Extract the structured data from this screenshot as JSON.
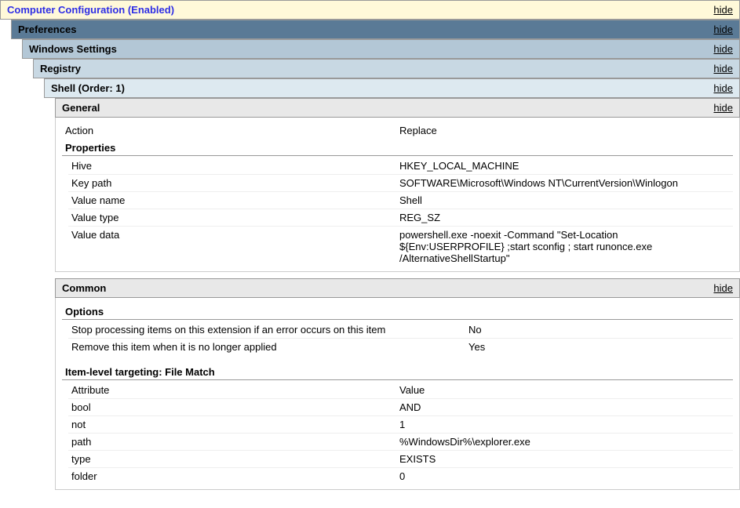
{
  "hide_label": "hide",
  "sections": {
    "computer_config": "Computer Configuration (Enabled)",
    "preferences": "Preferences",
    "windows_settings": "Windows Settings",
    "registry": "Registry",
    "shell": "Shell (Order: 1)",
    "general": "General",
    "common": "Common"
  },
  "general": {
    "action_label": "Action",
    "action_value": "Replace",
    "properties_header": "Properties",
    "rows": [
      {
        "label": "Hive",
        "value": "HKEY_LOCAL_MACHINE"
      },
      {
        "label": "Key path",
        "value": "SOFTWARE\\Microsoft\\Windows NT\\CurrentVersion\\Winlogon"
      },
      {
        "label": "Value name",
        "value": "Shell"
      },
      {
        "label": "Value type",
        "value": "REG_SZ"
      },
      {
        "label": "Value data",
        "value": "powershell.exe -noexit -Command \"Set-Location ${Env:USERPROFILE} ;start sconfig ; start runonce.exe /AlternativeShellStartup\""
      }
    ]
  },
  "common": {
    "options_header": "Options",
    "options": [
      {
        "label": "Stop processing items on this extension if an error occurs on this item",
        "value": "No"
      },
      {
        "label": "Remove this item when it is no longer applied",
        "value": "Yes"
      }
    ],
    "targeting_header": "Item-level targeting: File Match",
    "targeting_cols": {
      "attr": "Attribute",
      "val": "Value"
    },
    "targeting": [
      {
        "label": "bool",
        "value": "AND"
      },
      {
        "label": "not",
        "value": "1"
      },
      {
        "label": "path",
        "value": "%WindowsDir%\\explorer.exe"
      },
      {
        "label": "type",
        "value": "EXISTS"
      },
      {
        "label": "folder",
        "value": "0"
      }
    ]
  }
}
